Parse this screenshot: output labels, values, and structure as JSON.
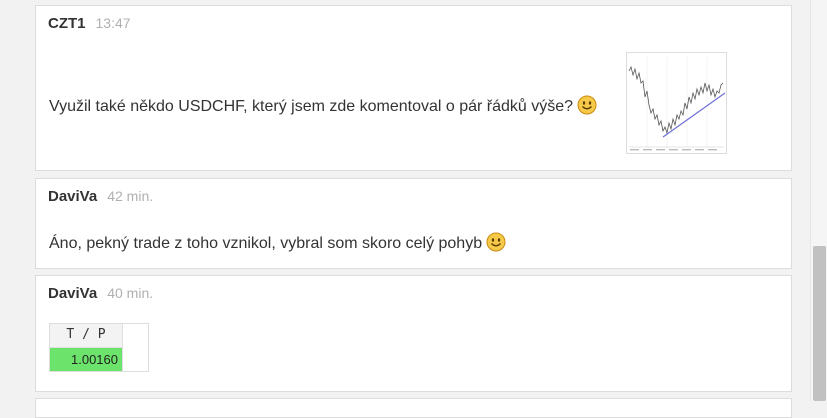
{
  "posts": [
    {
      "author": "CZT1",
      "time": "13:47",
      "text": "Využil také někdo USDCHF, který jsem zde komentoval o pár řádků výše?",
      "emoji_icon": "smiley-icon"
    },
    {
      "author": "DaviVa",
      "time": "42 min.",
      "text": "Áno, pekný trade z toho vznikol, vybral som skoro celý pohyb",
      "emoji_icon": "smiley-icon"
    },
    {
      "author": "DaviVa",
      "time": "40 min.",
      "tp_table": {
        "header": "T / P",
        "value": "1.00160",
        "highlight_color": "#6ce46c"
      }
    }
  ]
}
